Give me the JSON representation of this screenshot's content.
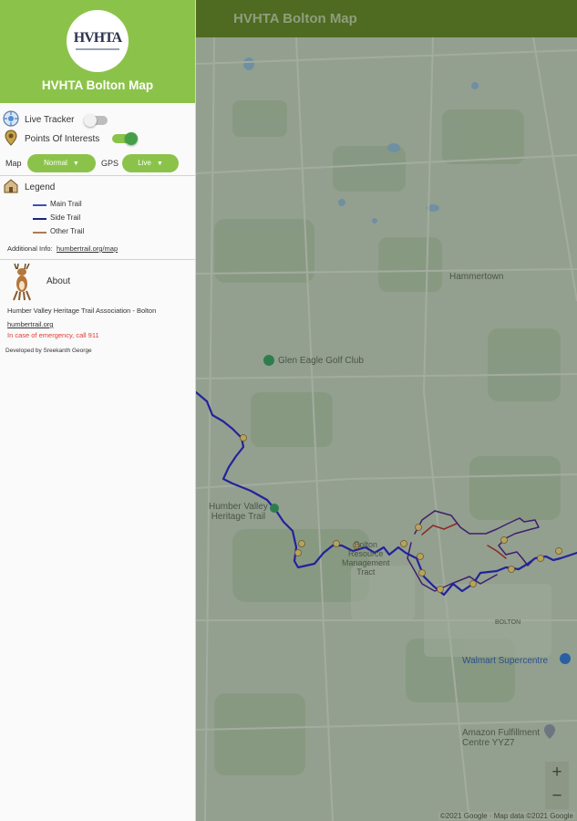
{
  "appbar": {
    "title": "HVHTA Bolton Map"
  },
  "drawer": {
    "logo_text": "HVHTA",
    "app_name": "HVHTA Bolton Map",
    "live_tracker": {
      "label": "Live Tracker",
      "enabled": false
    },
    "points_of_interests": {
      "label": "Points Of Interests",
      "enabled": true
    },
    "map_select": {
      "label": "Map",
      "value": "Normal"
    },
    "gps_select": {
      "label": "GPS",
      "value": "Live"
    },
    "legend": {
      "title": "Legend",
      "items": [
        {
          "label": "Main Trail",
          "color": "#3f51b5"
        },
        {
          "label": "Side Trail",
          "color": "#1a237e"
        },
        {
          "label": "Other Trail",
          "color": "#b07a4f"
        }
      ]
    },
    "additional_info": {
      "label": "Additional Info:",
      "link": "humbertrail.org/map"
    },
    "about": {
      "title": "About",
      "org": "Humber Valley Heritage Trail Association - Bolton",
      "website": "humbertrail.org",
      "emergency": "In case of emergency, call 911",
      "developer": "Developed by Sreekanth George"
    }
  },
  "map": {
    "labels": {
      "hammertown": "Hammertown",
      "glen_eagle": "Glen Eagle Golf Club",
      "humber_valley": "Humber Valley\nHeritage Trail",
      "bolton_resource": "Bolton\nResource\nManagement\nTract",
      "bolton": "BOLTON",
      "walmart": "Walmart Supercentre",
      "amazon": "Amazon Fulfillment\nCentre YYZ7"
    },
    "zoom_in": "+",
    "zoom_out": "−",
    "attribution": "©2021 Google · Map data ©2021 Google"
  },
  "colors": {
    "accent": "#8bc34a",
    "appbar": "#4f6a21",
    "emergency": "#e53935"
  }
}
